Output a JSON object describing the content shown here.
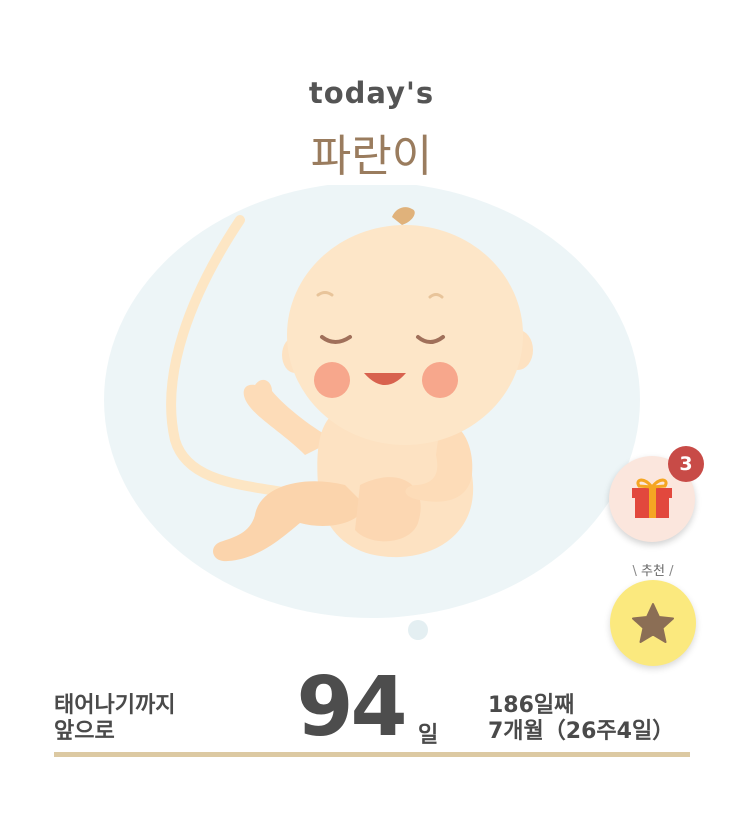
{
  "header": {
    "subtitle": "today's",
    "baby_name": "파란이"
  },
  "gift": {
    "badge_count": "3",
    "icon": "gift-icon"
  },
  "recommend": {
    "label": "추천",
    "icon": "star-icon"
  },
  "countdown": {
    "left_line1": "태어나기까지",
    "left_line2": "앞으로",
    "days_remaining": "94",
    "unit": "일",
    "day_count": "186일째",
    "pregnancy_week": "7개월（26주4일）"
  },
  "colors": {
    "title_brown": "#9a7c5e",
    "gift_bg": "#fbe6dd",
    "badge_red": "#c84b47",
    "star_bg": "#fbe97e",
    "rule_tan": "#dcc9a2",
    "bubble_blue": "#edf5f7"
  }
}
